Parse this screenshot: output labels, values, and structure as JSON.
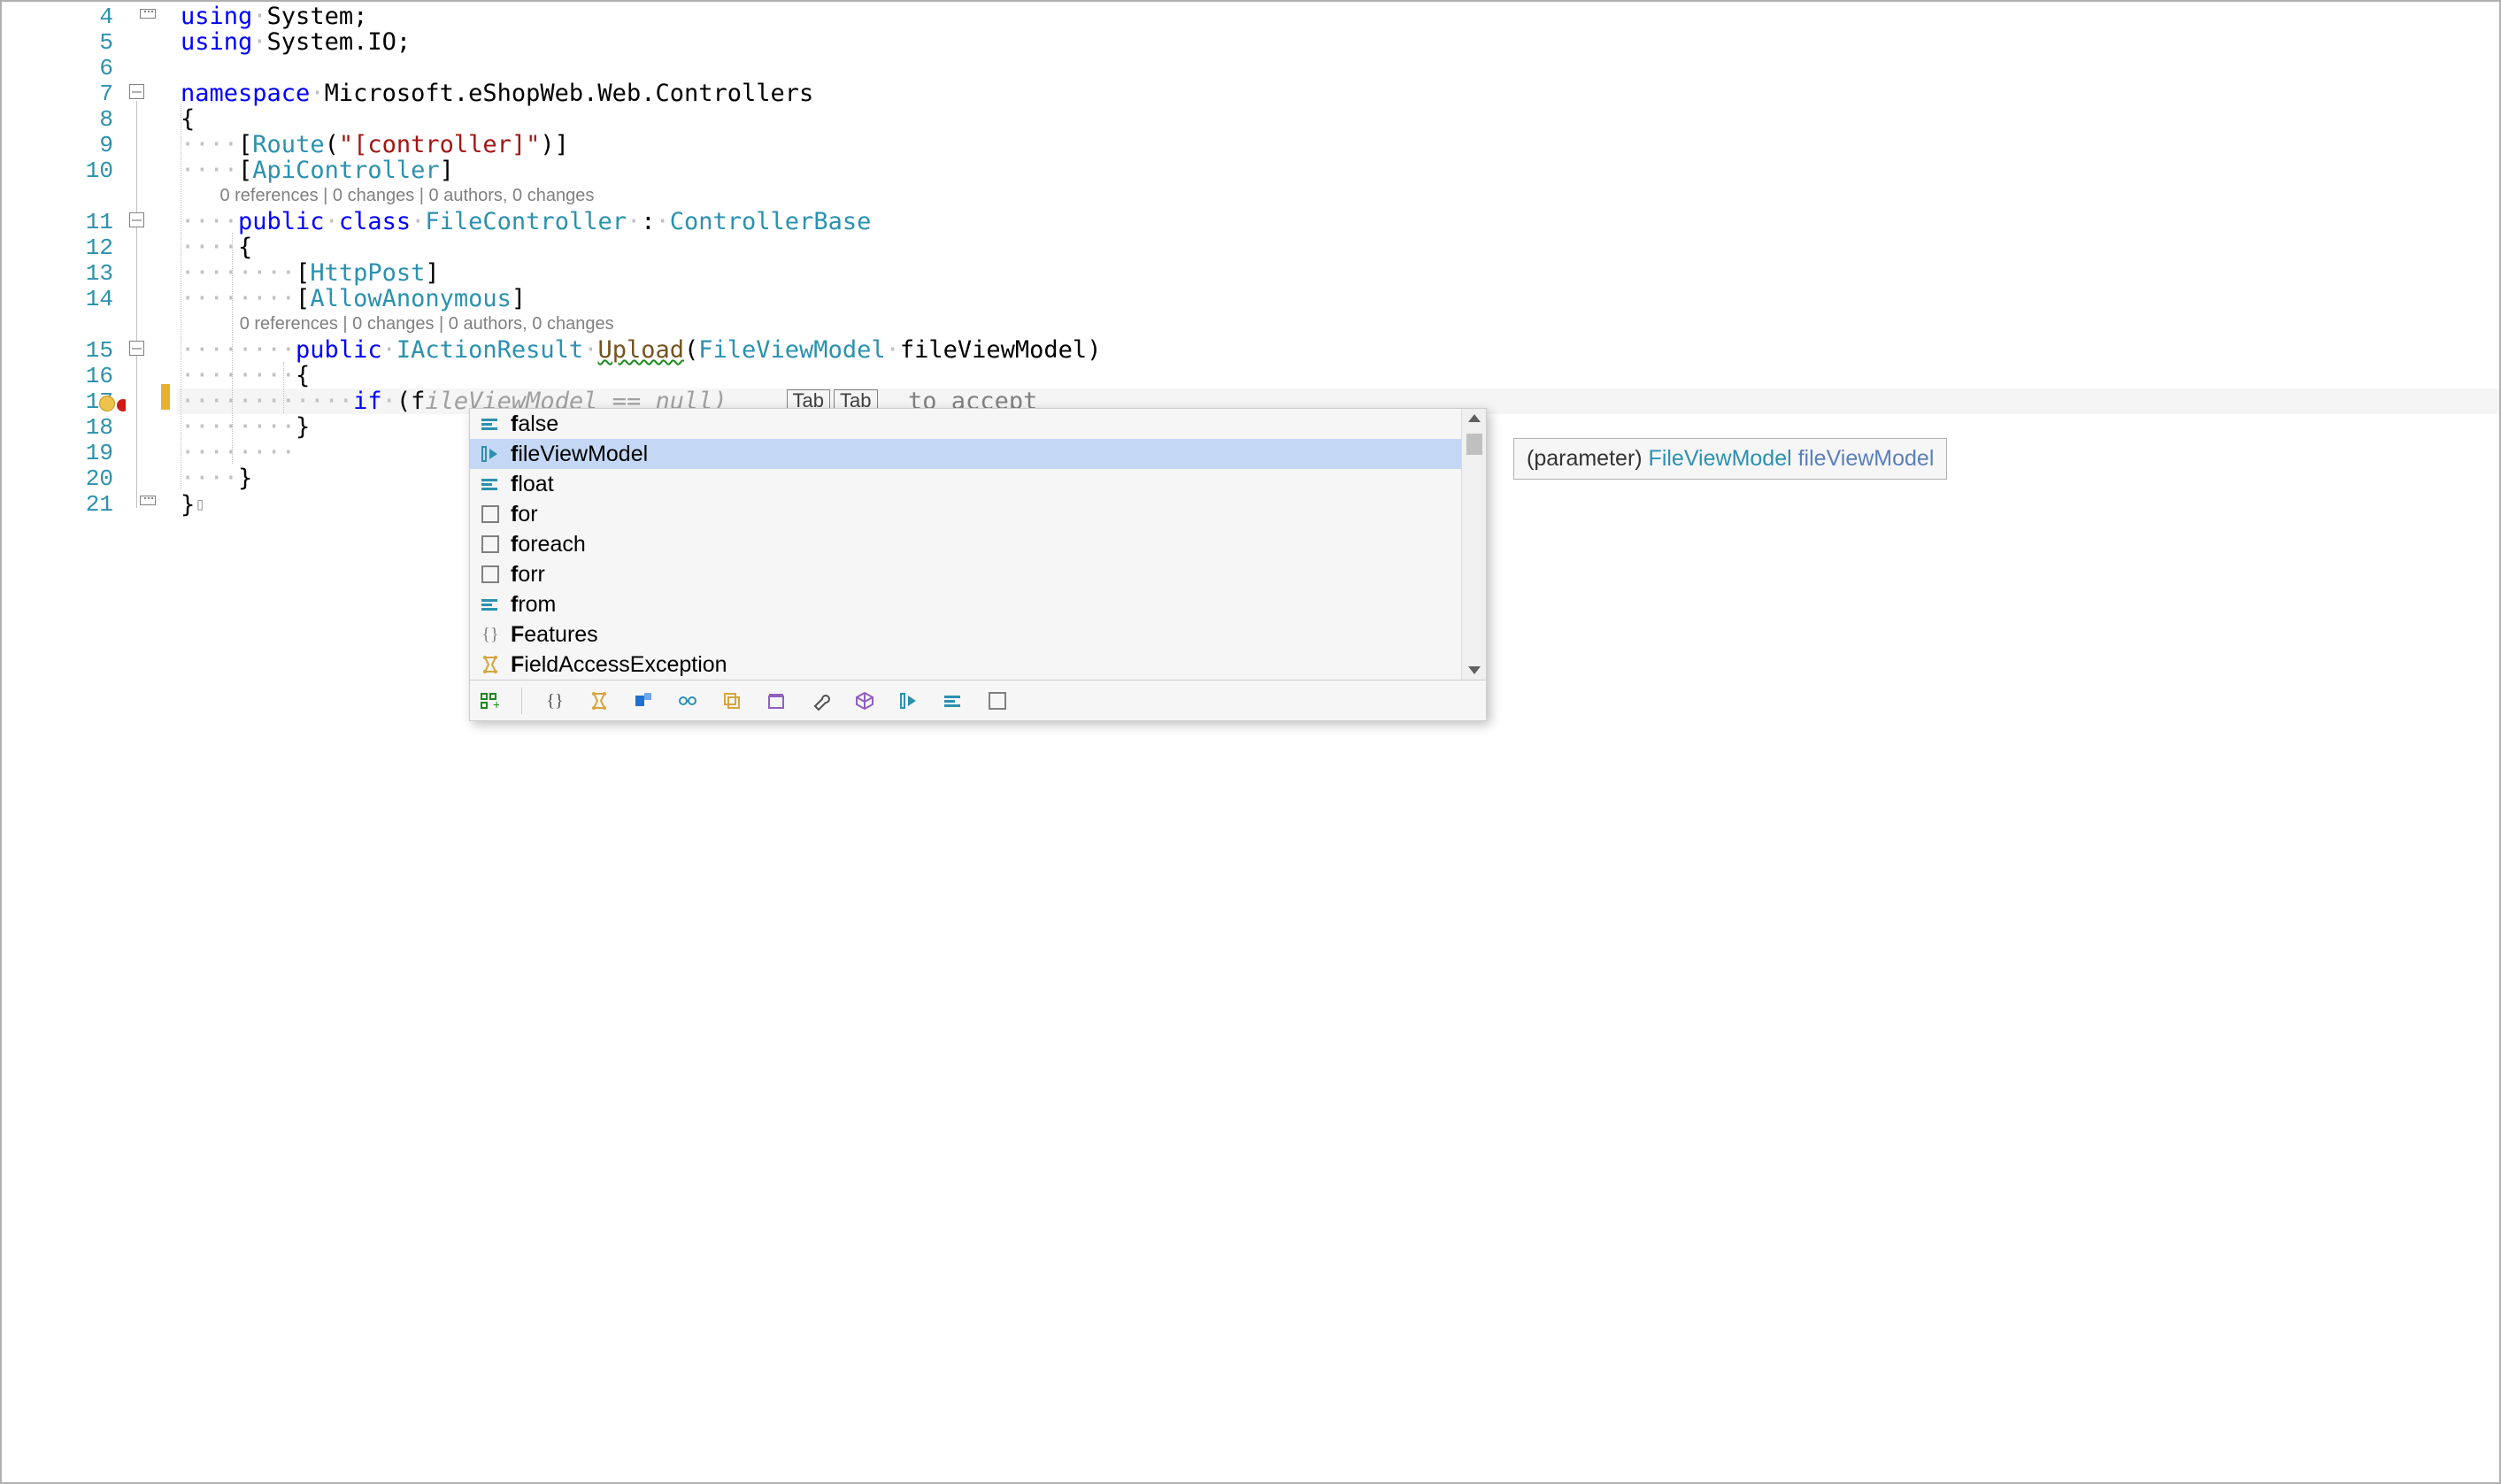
{
  "gutter": {
    "lines": [
      "4",
      "5",
      "6",
      "7",
      "8",
      "9",
      "10",
      "",
      "11",
      "12",
      "13",
      "14",
      "",
      "15",
      "16",
      "17",
      "18",
      "19",
      "20",
      "21"
    ],
    "error_line_index": 15
  },
  "codelens": {
    "class": "0 references | 0 changes | 0 authors, 0 changes",
    "method": "0 references | 0 changes | 0 authors, 0 changes"
  },
  "code": {
    "l4": {
      "kw": "using",
      "rest": "System;"
    },
    "l5": {
      "kw": "using",
      "rest": "System.IO;"
    },
    "l7": {
      "kw": "namespace",
      "rest": "Microsoft.eShopWeb.Web.Controllers"
    },
    "l8": "{",
    "l9": {
      "attr1": "Route",
      "str": "\"[controller]\""
    },
    "l10": {
      "attr": "ApiController"
    },
    "l11": {
      "kw1": "public",
      "kw2": "class",
      "name": "FileController",
      "base": "ControllerBase"
    },
    "l12": "{",
    "l13": {
      "attr": "HttpPost"
    },
    "l14": {
      "attr": "AllowAnonymous"
    },
    "l15": {
      "kw": "public",
      "ret": "IActionResult",
      "name": "Upload",
      "ptype": "FileViewModel",
      "pname": "fileViewModel"
    },
    "l16": "{",
    "l17": {
      "kw": "if",
      "typed": "f",
      "ghost": "ileViewModel == null)",
      "hint_tab": "Tab",
      "hint_text": "to accept"
    },
    "l18": "}",
    "l20": "}",
    "l21": "}"
  },
  "completion": {
    "items": [
      {
        "icon": "keyword",
        "pre": "f",
        "rest": "alse"
      },
      {
        "icon": "param",
        "pre": "f",
        "rest": "ileViewModel",
        "selected": true
      },
      {
        "icon": "keyword",
        "pre": "f",
        "rest": "loat"
      },
      {
        "icon": "snippet",
        "pre": "f",
        "rest": "or"
      },
      {
        "icon": "snippet",
        "pre": "f",
        "rest": "oreach"
      },
      {
        "icon": "snippet",
        "pre": "f",
        "rest": "orr"
      },
      {
        "icon": "keyword",
        "pre": "f",
        "rest": "rom"
      },
      {
        "icon": "namespace",
        "pre": "F",
        "rest": "eatures"
      },
      {
        "icon": "class",
        "pre": "F",
        "rest": "ieldAccessException"
      }
    ],
    "toolbar": [
      "target",
      "braces",
      "class2",
      "component",
      "link",
      "stack",
      "package",
      "wrench",
      "cube",
      "param2",
      "keyword2",
      "snippet2"
    ]
  },
  "tooltip": {
    "prefix": "(parameter) ",
    "type": "FileViewModel",
    "name": "fileViewModel"
  }
}
